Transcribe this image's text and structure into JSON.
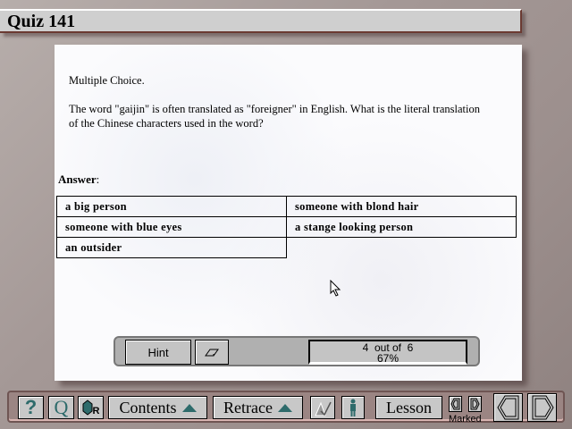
{
  "title": "Quiz 141",
  "question": {
    "type": "Multiple Choice.",
    "text": "The word \"gaijin\" is often translated as \"foreigner\" in English. What is the literal translation of the Chinese characters used in the word?"
  },
  "answer_label": "Answer",
  "answer_colon": ":",
  "options": [
    "a big person",
    "someone with blond hair",
    "someone with blue eyes",
    "a stange looking person",
    "an outsider"
  ],
  "hint_label": "Hint",
  "progress": {
    "line1": "4  out of  6",
    "line2": "67%",
    "correct": 4,
    "total": 6,
    "percent": 67
  },
  "toolbar": {
    "help": "?",
    "quiz": "Q",
    "book_r": "R",
    "contents": "Contents",
    "retrace": "Retrace",
    "lesson": "Lesson",
    "marked": "Marked"
  }
}
